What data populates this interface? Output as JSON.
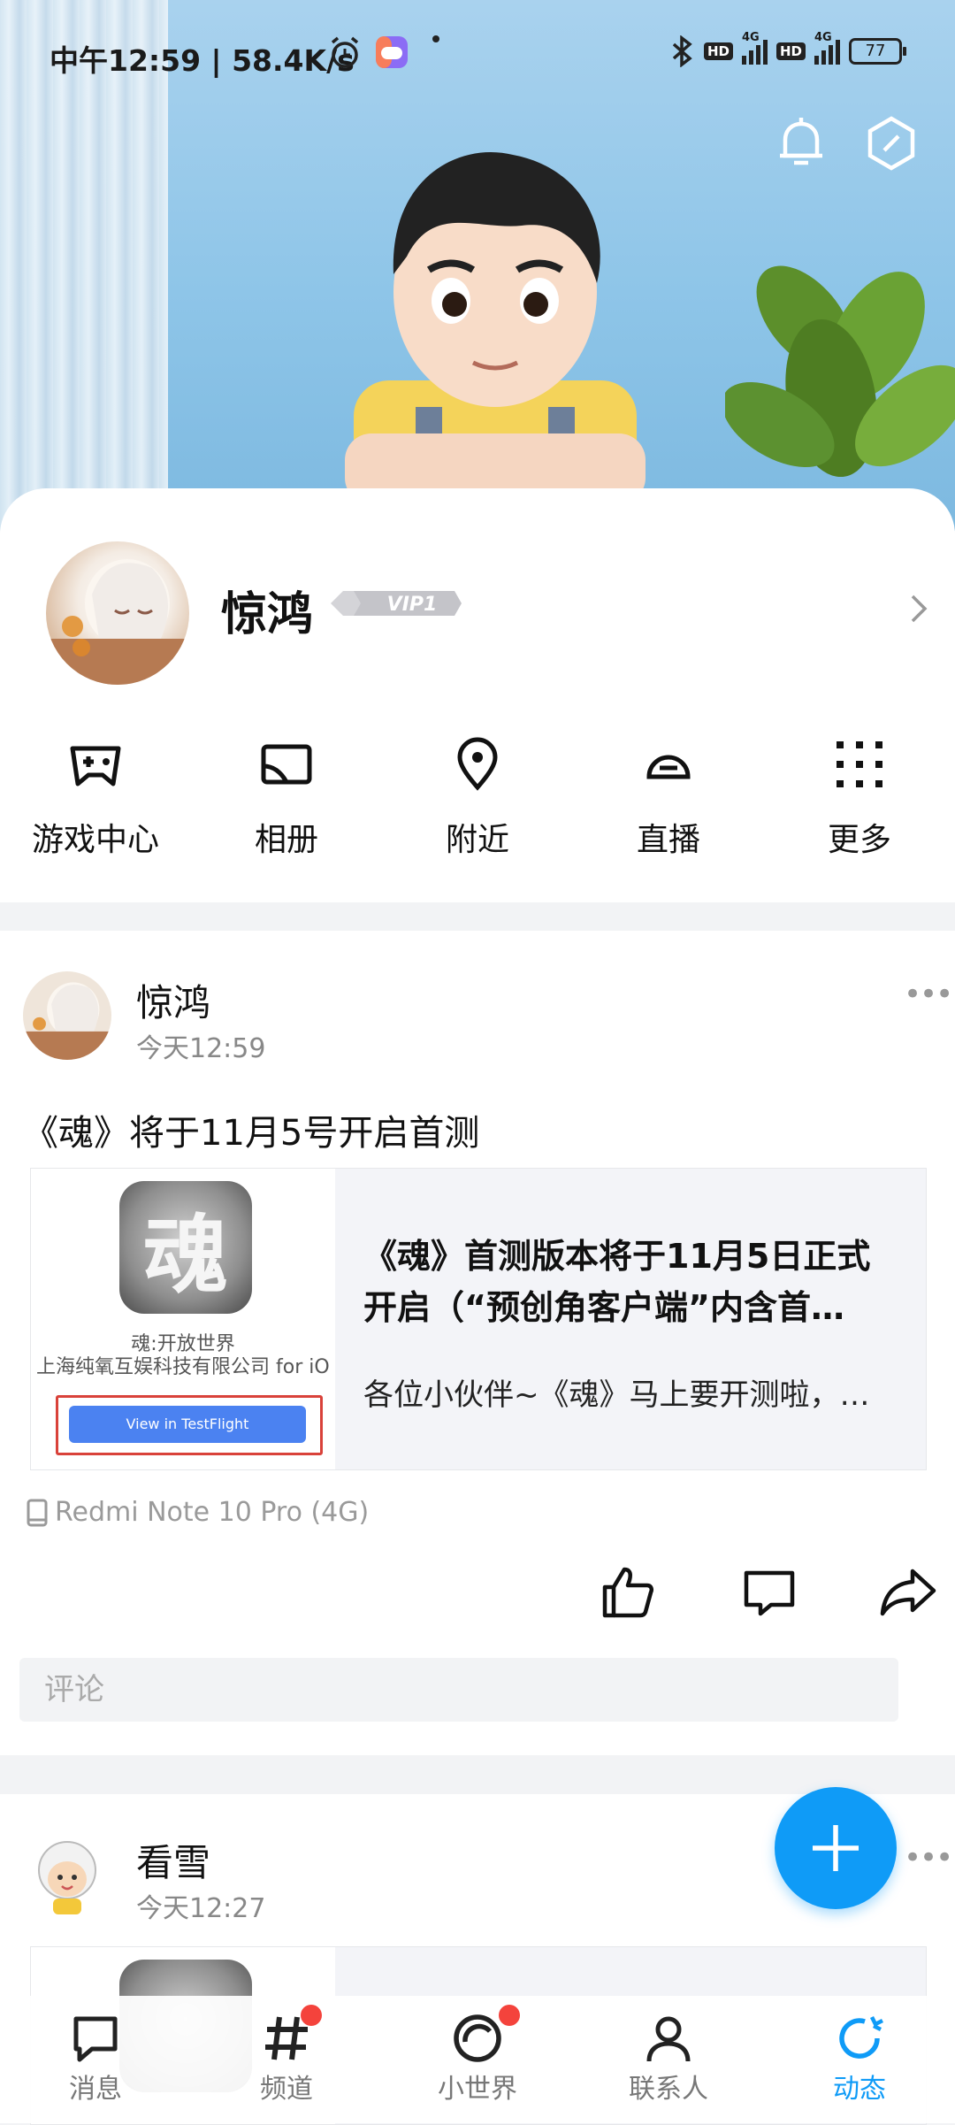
{
  "status_bar": {
    "time_speed": "中午12:59 | 58.4K/s",
    "network1": "4G",
    "network2": "4G",
    "hd1": "HD",
    "hd2": "HD",
    "battery": "77"
  },
  "header_icons": [
    "bell-icon",
    "hexagon-settings-icon"
  ],
  "profile": {
    "name": "惊鸿",
    "vip": "VIP1"
  },
  "quick_actions": [
    {
      "label": "游戏中心",
      "icon": "gamepad-icon"
    },
    {
      "label": "相册",
      "icon": "photo-album-icon"
    },
    {
      "label": "附近",
      "icon": "location-pin-icon"
    },
    {
      "label": "直播",
      "icon": "live-icon"
    },
    {
      "label": "更多",
      "icon": "grid-dots-icon"
    }
  ],
  "post1": {
    "author": "惊鸿",
    "time": "今天12:59",
    "text": "《魂》将于11月5号开启首测",
    "card": {
      "app_name": "魂:开放世界",
      "company": "上海纯氧互娱科技有限公司 for iO",
      "button": "View in TestFlight",
      "title": "《魂》首测版本将于11月5日正式开启（“预创角客户端”内含首…",
      "desc": "各位小伙伴~《魂》马上要开测啦，…"
    },
    "device": "Redmi Note 10 Pro (4G)",
    "comment_placeholder": "评论"
  },
  "post2": {
    "author": "看雪",
    "time": "今天12:27"
  },
  "tabs": [
    {
      "label": "消息",
      "icon": "message-icon",
      "badge": false,
      "active": false
    },
    {
      "label": "频道",
      "icon": "hashtag-icon",
      "badge": true,
      "active": false
    },
    {
      "label": "小世界",
      "icon": "small-world-icon",
      "badge": true,
      "active": false
    },
    {
      "label": "联系人",
      "icon": "contacts-icon",
      "badge": false,
      "active": false
    },
    {
      "label": "动态",
      "icon": "feed-refresh-icon",
      "badge": false,
      "active": true
    }
  ],
  "colors": {
    "accent": "#0f9bf7",
    "badge_red": "#f4433c",
    "testflight_blue": "#4b82f1"
  }
}
